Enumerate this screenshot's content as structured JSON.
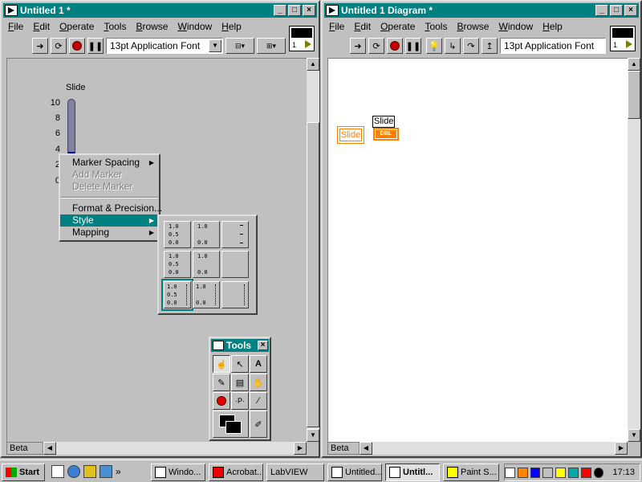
{
  "front_panel": {
    "title": "Untitled 1 *",
    "menu": [
      "File",
      "Edit",
      "Operate",
      "Tools",
      "Browse",
      "Window",
      "Help"
    ],
    "font": "13pt Application Font",
    "connector_number": "1",
    "status": "Beta",
    "slide": {
      "label": "Slide",
      "value": 4,
      "min": 0,
      "max": 10,
      "ticks": [
        "10",
        "8",
        "6",
        "4",
        "2",
        "0"
      ],
      "fill_color": "#0000ff"
    }
  },
  "context_menu": {
    "items": [
      {
        "label": "Marker Spacing",
        "has_submenu": true,
        "disabled": false
      },
      {
        "label": "Add Marker",
        "has_submenu": false,
        "disabled": true
      },
      {
        "label": "Delete Marker",
        "has_submenu": false,
        "disabled": true
      },
      {
        "label": "Format & Precision...",
        "has_submenu": false,
        "disabled": false
      },
      {
        "label": "Style",
        "has_submenu": true,
        "disabled": false,
        "selected": true
      },
      {
        "label": "Mapping",
        "has_submenu": true,
        "disabled": false
      }
    ]
  },
  "style_palette": {
    "cells": [
      [
        "1.0",
        "0.5",
        "0.0"
      ],
      [
        "1.0",
        "",
        "0.0"
      ],
      [
        "",
        "",
        ""
      ],
      [
        "1.0",
        "0.5",
        "0.0"
      ],
      [
        "1.0",
        "",
        "0.0"
      ],
      [
        "",
        "",
        ""
      ],
      [
        "1.0",
        "0.5",
        "0.0"
      ],
      [
        "1.0",
        "",
        "0.0"
      ],
      [
        "",
        "",
        ""
      ]
    ]
  },
  "tools_palette": {
    "title": "Tools",
    "close": "×"
  },
  "diagram": {
    "title": "Untitled 1 Diagram *",
    "menu": [
      "File",
      "Edit",
      "Operate",
      "Tools",
      "Browse",
      "Window",
      "Help"
    ],
    "font": "13pt Application Font",
    "connector_number": "1",
    "status": "Beta",
    "terminal_label": "Slide",
    "local_label": "Slide",
    "terminal_type": "DBL",
    "accent": "#ff8000"
  },
  "taskbar": {
    "start": "Start",
    "buttons": [
      {
        "label": "Windo...",
        "active": false
      },
      {
        "label": "Acrobat...",
        "active": false
      },
      {
        "label": "LabVIEW",
        "active": false
      },
      {
        "label": "Untitled...",
        "active": false
      },
      {
        "label": "Untitl...",
        "active": true
      },
      {
        "label": "Paint S...",
        "active": false
      }
    ],
    "quicklaunch_more": "»",
    "clock": "17:13"
  }
}
